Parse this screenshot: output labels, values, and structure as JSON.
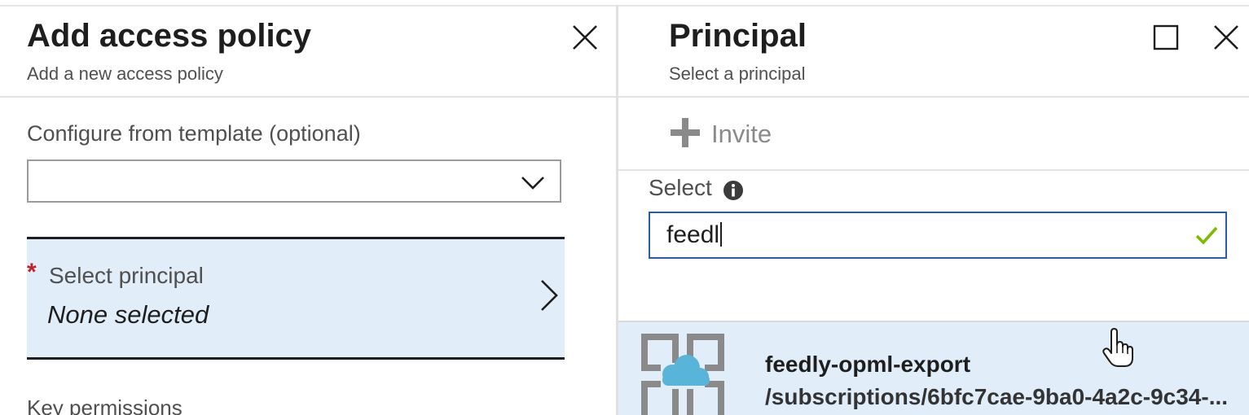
{
  "left_panel": {
    "title": "Add access policy",
    "subtitle": "Add a new access policy",
    "template": {
      "label": "Configure from template (optional)",
      "value": ""
    },
    "principal": {
      "required_mark": "*",
      "label": "Select principal",
      "value": "None selected"
    },
    "key_permissions_label": "Key permissions"
  },
  "right_panel": {
    "title": "Principal",
    "subtitle": "Select a principal",
    "invite_label": "Invite",
    "select_label": "Select",
    "search_value": "feedl",
    "results": [
      {
        "name": "feedly-opml-export",
        "path": "/subscriptions/6bfc7cae-9ba0-4a2c-9c34-..."
      }
    ]
  },
  "icons": {
    "close": "close-icon",
    "maximize": "maximize-icon",
    "chevron_down": "chevron-down-icon",
    "chevron_right": "chevron-right-icon",
    "plus": "plus-icon",
    "info": "info-icon",
    "check": "checkmark-icon",
    "app": "app-registration-icon",
    "pointer": "hand-pointer-icon"
  },
  "colors": {
    "selected_row_bg": "#e1edf9",
    "input_focus_border": "#2f5aa7",
    "valid_check": "#7fba00",
    "required_mark": "#c3222a",
    "cloud": "#59b4d9"
  }
}
